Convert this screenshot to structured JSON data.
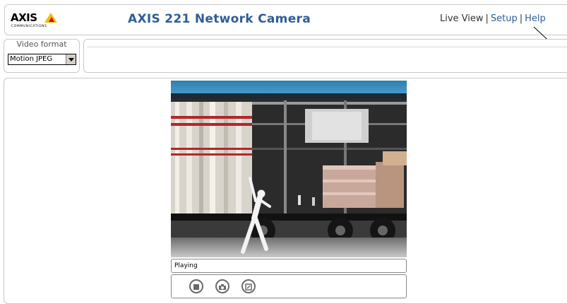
{
  "header": {
    "logo_text": "AXIS",
    "logo_subtext": "COMMUNICATIONS",
    "title": "AXIS 221 Network Camera",
    "nav": {
      "live_view": "Live View",
      "setup": "Setup",
      "help": "Help",
      "separator": "|"
    }
  },
  "video_format": {
    "label": "Video format",
    "selected": "Motion JPEG"
  },
  "player": {
    "status": "Playing",
    "controls": [
      "stop-icon",
      "snapshot-icon",
      "view-full-image-icon"
    ]
  },
  "colors": {
    "title": "#2f5d99",
    "link": "#2f5d99",
    "border": "#c8c8c8"
  }
}
